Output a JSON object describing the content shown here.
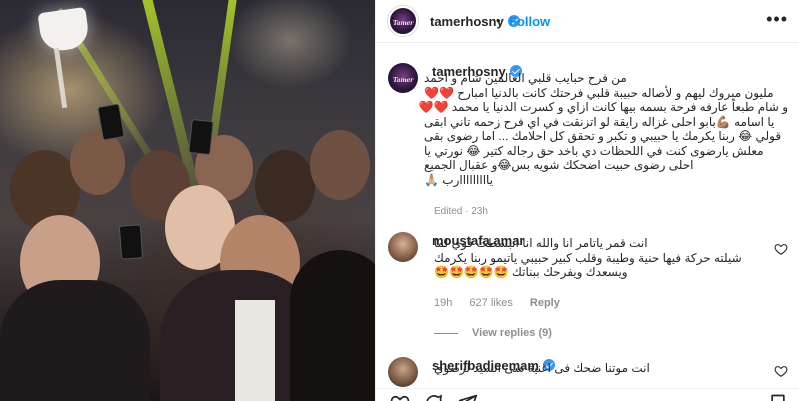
{
  "post": {
    "author": "tamerhosny",
    "avatar_text": "Tamer",
    "follow_label": "Follow",
    "dot": "•",
    "more_label": "•••",
    "caption_lines": [
      "من فرح حبايب قلبي العالمين شام و احمد",
      "مليون مبروك ليهم و لأصاله حبيبة قلبي فرحتك كانت بالدنيا امبارح ❤️❤️",
      "و شام طبعاً عارفه فرحة بسمه بيها كانت ازاي و كسرت الدنيا يا محمد ❤️❤️",
      "يا اسامه 💪🏽بابو احلى غزاله رايقة لو اتزنقت في اي فرح زحمه تاني ابقى",
      "قولي 😂 ربنا يكرمك يا حبيبي و تكبر و تحقق كل احلامك ... اما رضوى بقى",
      "معلش يارضوى كنت في اللحظات دي باخد حق رجاله كتير 😂 نورتي يا",
      "احلى رضوى حبيت اضحكك شويه بس😂و عقبال الجميع",
      "يااااااااارب 🙏🏼"
    ],
    "edited": "Edited · 23h"
  },
  "comments": [
    {
      "author": "moustafa.amar",
      "lines": [
        "انت قمر ياتامر انا والله انا انبسطت قوي لما",
        "شيلته حركة فيها حنية وطيبة وقلب كبير حبيبي ياتيمو ربنا يكرمك",
        "ويسعدك ويفرحك ببناتك 🤩🤩🤩🤩🤩"
      ],
      "time": "19h",
      "likes": "627 likes",
      "reply_label": "Reply",
      "view_replies": "View replies (9)"
    },
    {
      "author": "sherifbadieemam",
      "lines": [
        "انت موتنا ضحك فى اغنية سى السيد لرضوي"
      ]
    }
  ],
  "icons": {
    "verified": "verified-badge-icon",
    "heart": "heart-icon",
    "comment": "comment-icon",
    "share": "share-icon",
    "save": "bookmark-icon"
  },
  "colors": {
    "accent": "#0095f6",
    "verified": "#3897f0",
    "heart_fill": "#ed4956"
  }
}
